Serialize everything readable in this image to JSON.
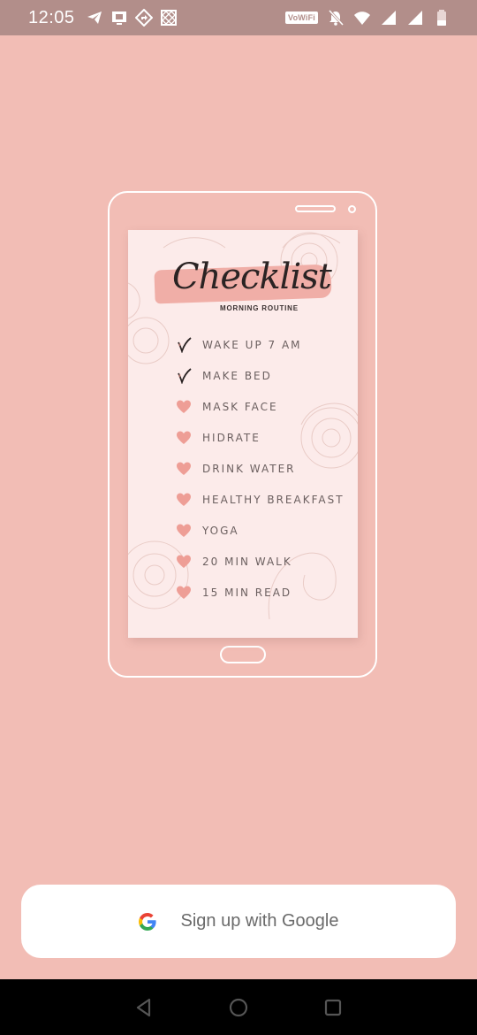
{
  "status_bar": {
    "time": "12:05",
    "vowifi": "VoWiFi",
    "icons_left": [
      "telegram-icon",
      "screen-icon",
      "navigation-icon",
      "grid-icon"
    ],
    "icons_right": [
      "mute-icon",
      "wifi-icon",
      "signal-icon",
      "signal-icon",
      "battery-icon"
    ]
  },
  "illustration": {
    "title": "Checklist",
    "subtitle": "MORNING ROUTINE",
    "items": [
      {
        "label": "WAKE UP 7 AM",
        "marker": "check"
      },
      {
        "label": "MAKE BED",
        "marker": "check"
      },
      {
        "label": "MASK FACE",
        "marker": "heart"
      },
      {
        "label": "HIDRATE",
        "marker": "heart"
      },
      {
        "label": "DRINK WATER",
        "marker": "heart"
      },
      {
        "label": "HEALTHY BREAKFAST",
        "marker": "heart"
      },
      {
        "label": "YOGA",
        "marker": "heart"
      },
      {
        "label": "20 MIN WALK",
        "marker": "heart"
      },
      {
        "label": "15 MIN READ",
        "marker": "heart"
      }
    ]
  },
  "signup": {
    "google_label": "Sign up with Google"
  },
  "nav": {
    "buttons": [
      "back-icon",
      "home-icon",
      "recents-icon"
    ]
  },
  "colors": {
    "background": "#f2bdb5",
    "status_bar": "#b28e8a",
    "card": "#fcebea",
    "heart": "#ee9e96",
    "brush": "#f0aea7"
  }
}
